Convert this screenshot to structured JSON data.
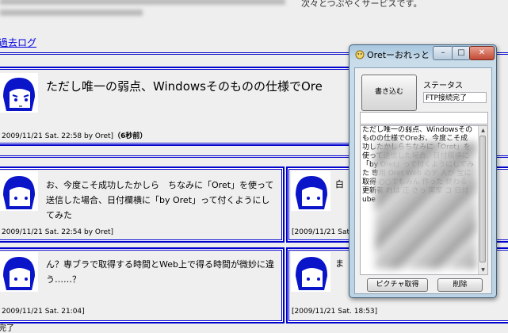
{
  "intro": {
    "tail_text": "次々とつぶやくサービスです。"
  },
  "nav": {
    "past_log": "過去ログ"
  },
  "posts": [
    {
      "text": "ただし唯一の弱点、Windowsそのものの仕様でOre",
      "meta": "2009/11/21 Sat. 22:58 by Oret]",
      "ago": "（6秒前）"
    },
    {
      "text": "お、今度こそ成功したかしら　ちなみに「Oret」を使って送信した場合、日付欄横に「by Oret」って付くようにしてみた",
      "meta": "2009/11/21 Sat. 22:54 by Oret]"
    },
    {
      "text": "白",
      "meta": "[2009/11/21 Sat"
    },
    {
      "text": "ん？専ブラで取得する時間とWeb上で得る時間が微妙に違う……？",
      "meta": "2009/11/21 Sat. 21:04]"
    },
    {
      "text": "ま",
      "meta": "[2009/11/21 Sat. 18:53]"
    }
  ],
  "status_left": "完了",
  "window": {
    "title": "Oretーおれっと",
    "min_glyph": "–",
    "max_glyph": "□",
    "close_glyph": "✕",
    "write_button": "書き込む",
    "status_label": "ステータス",
    "status_value": "FTP接続完了",
    "input_value": "",
    "textarea_text": "ただし唯一の弱点、Windowsそのものの仕様でOreお、今度こそ成功したかしらちなみに「Oret」を使って送信した場合、日付欄横に「by Oret」って付くようにしてみた 専用 Oret Web のデ 人が 宝に 取得 ○○でもみん 作った 終わる 更新者 れは 正 さっ 実家 コ 日付 ube",
    "capture_button": "ピクチャ取得",
    "delete_button": "削除"
  },
  "colors": {
    "link": "#0000dd",
    "frame": "#0000cc"
  }
}
